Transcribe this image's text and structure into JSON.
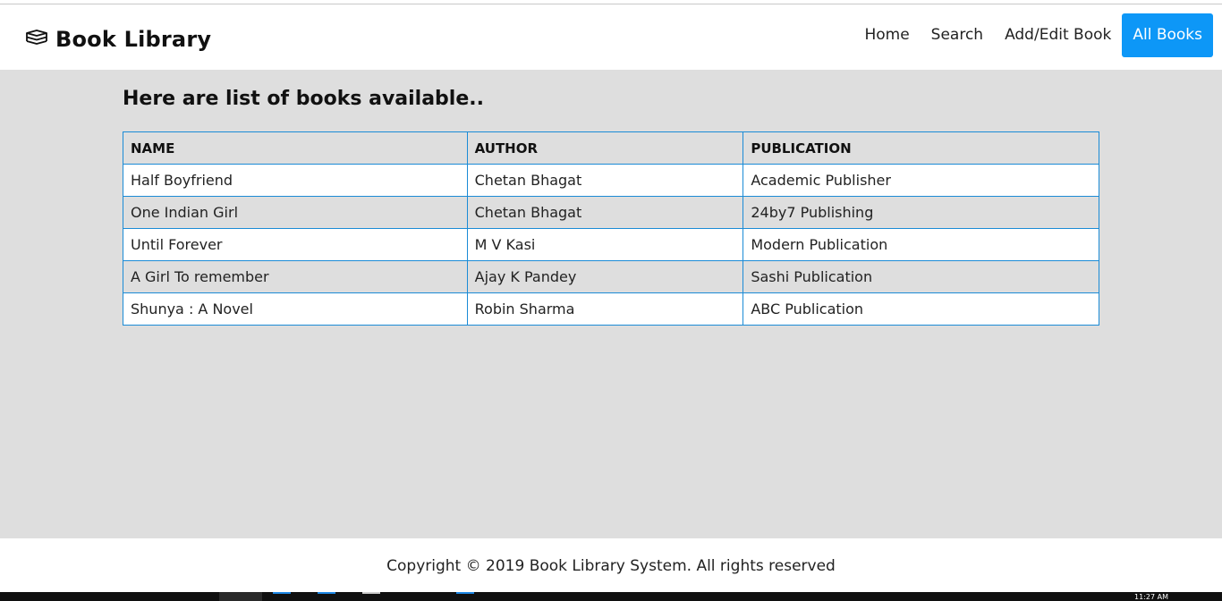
{
  "brand": {
    "title": "Book Library",
    "icon": "books-stack-icon"
  },
  "nav": {
    "items": [
      {
        "label": "Home",
        "active": false
      },
      {
        "label": "Search",
        "active": false
      },
      {
        "label": "Add/Edit Book",
        "active": false
      },
      {
        "label": "All Books",
        "active": true
      }
    ],
    "active_color": "#0d97f7"
  },
  "main": {
    "heading": "Here are list of books available..",
    "table": {
      "columns": [
        "NAME",
        "AUTHOR",
        "PUBLICATION"
      ],
      "rows": [
        [
          "Half Boyfriend",
          "Chetan Bhagat",
          "Academic Publisher"
        ],
        [
          "One Indian Girl",
          "Chetan Bhagat",
          "24by7 Publishing"
        ],
        [
          "Until Forever",
          "M V Kasi",
          "Modern Publication"
        ],
        [
          "A Girl To remember",
          "Ajay K Pandey",
          "Sashi Publication"
        ],
        [
          "Shunya : A Novel",
          "Robin Sharma",
          "ABC Publication"
        ]
      ],
      "border_color": "#1b8bd6"
    }
  },
  "footer": {
    "text": "Copyright © 2019 Book Library System. All rights reserved"
  },
  "taskbar": {
    "clock": "11:27 AM"
  },
  "colors": {
    "page_bg": "#dedede",
    "navbar_bg": "#ffffff"
  }
}
